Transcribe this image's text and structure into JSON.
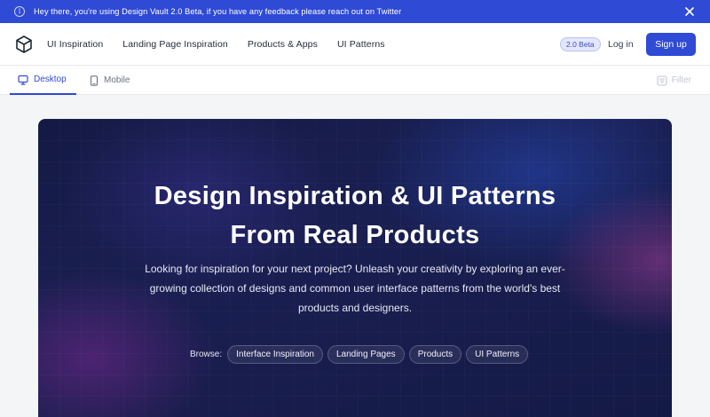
{
  "banner": {
    "info_icon": "info-circle-icon",
    "message": "Hey there, you're using Design Vault 2.0 Beta, if you have any feedback please reach out on Twitter",
    "close_icon": "close-icon"
  },
  "header": {
    "logo_icon": "cube-logo-icon",
    "nav": [
      "UI Inspiration",
      "Landing Page Inspiration",
      "Products & Apps",
      "UI Patterns"
    ],
    "beta_badge": "2.0 Beta",
    "login_label": "Log in",
    "signup_label": "Sign up"
  },
  "tabs": {
    "desktop_label": "Desktop",
    "mobile_label": "Mobile",
    "filter_label": "Filter"
  },
  "hero": {
    "title_line1": "Design Inspiration & UI Patterns",
    "title_line2": "From Real Products",
    "description": "Looking for inspiration for your next project? Unleash your creativity by exploring an ever-growing collection of designs and common user interface patterns from the world's best products and designers.",
    "browse_label": "Browse:",
    "chips": [
      "Interface Inspiration",
      "Landing Pages",
      "Products",
      "UI Patterns"
    ]
  },
  "colors": {
    "brand": "#2f4ad4",
    "hero_bg": "#161c4a"
  }
}
